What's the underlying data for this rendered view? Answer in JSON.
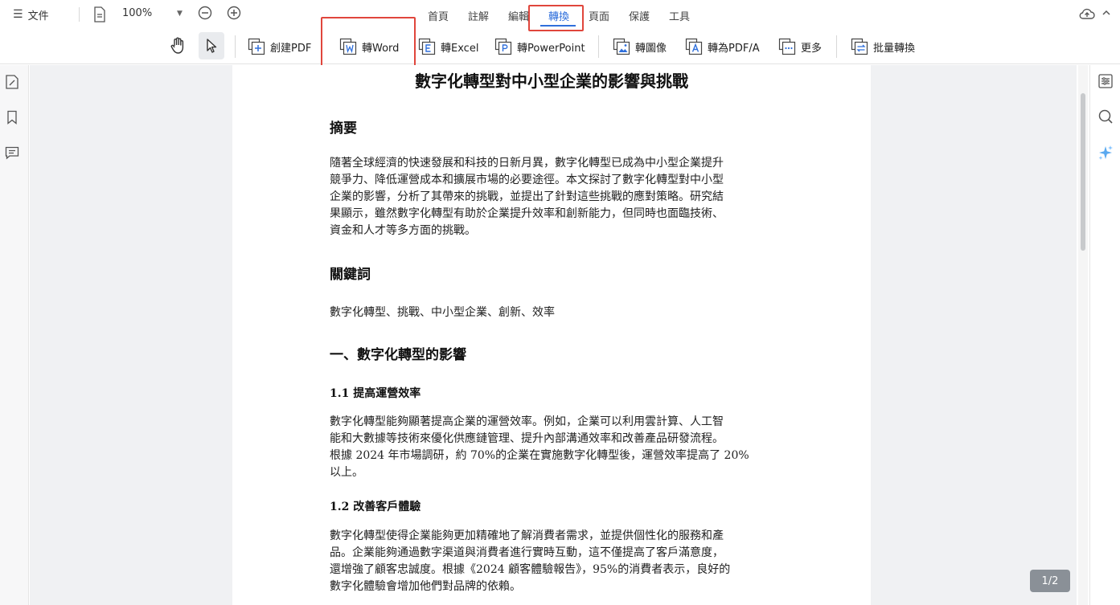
{
  "menu": {
    "file_label": "文件"
  },
  "zoom": {
    "value": "100%"
  },
  "tabs": [
    {
      "label": "首頁"
    },
    {
      "label": "註解"
    },
    {
      "label": "編輯"
    },
    {
      "label": "轉換"
    },
    {
      "label": "頁面"
    },
    {
      "label": "保護"
    },
    {
      "label": "工具"
    }
  ],
  "active_tab": "轉換",
  "toolbar": {
    "create_pdf": "創建PDF",
    "to_word": "轉Word",
    "to_excel": "轉Excel",
    "to_powerpoint": "轉PowerPoint",
    "to_image": "轉圖像",
    "to_pdfa": "轉為PDF/A",
    "more": "更多",
    "batch_convert": "批量轉換"
  },
  "document": {
    "title": "數字化轉型對中小型企業的影響與挑戰",
    "abstract_heading": "摘要",
    "abstract_lines": [
      "隨著全球經濟的快速發展和科技的日新月異，數字化轉型已成為中小型企業提升",
      "競爭力、降低運營成本和擴展市場的必要途徑。本文探討了數字化轉型對中小型",
      "企業的影響，分析了其帶來的挑戰，並提出了針對這些挑戰的應對策略。研究結",
      "果顯示，雖然數字化轉型有助於企業提升效率和創新能力，但同時也面臨技術、",
      "資金和人才等多方面的挑戰。"
    ],
    "keywords_heading": "關鍵詞",
    "keywords": "數字化轉型、挑戰、中小型企業、創新、效率",
    "section1_heading": "一、數字化轉型的影響",
    "sub1_heading": "1.1  提高運營效率",
    "sub1_lines": [
      "數字化轉型能夠顯著提高企業的運營效率。例如，企業可以利用雲計算、人工智",
      "能和大數據等技術來優化供應鏈管理、提升內部溝通效率和改善產品研發流程。",
      "根據 2024 年市場調研，約 70%的企業在實施數字化轉型後，運營效率提高了 20%",
      "以上。"
    ],
    "sub2_heading": "1.2  改善客戶體驗",
    "sub2_lines": [
      "數字化轉型使得企業能夠更加精確地了解消費者需求，並提供個性化的服務和產",
      "品。企業能夠通過數字渠道與消費者進行實時互動，這不僅提高了客戶滿意度，",
      "還增強了顧客忠誠度。根據《2024 顧客體驗報告》，95%的消費者表示，良好的",
      "數字化體驗會增加他們對品牌的依賴。"
    ]
  },
  "page_indicator": "1/2",
  "colors": {
    "accent": "#2f6fdb",
    "highlight_box": "#e0463c",
    "canvas": "#f0f1f3"
  }
}
